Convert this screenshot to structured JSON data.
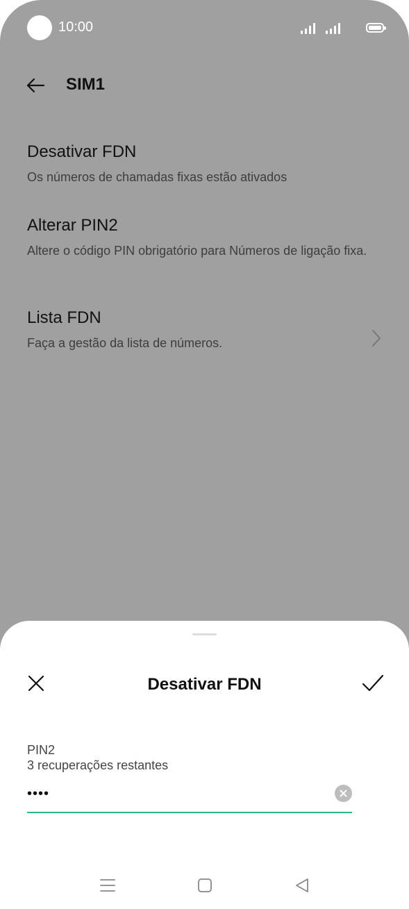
{
  "status_bar": {
    "time": "10:00"
  },
  "header": {
    "title": "SIM1"
  },
  "settings": [
    {
      "title": "Desativar FDN",
      "summary": "Os números de chamadas fixas estão ativados"
    },
    {
      "title": "Alterar PIN2",
      "summary": "Altere o código PIN obrigatório para Números de ligação fixa."
    },
    {
      "title": "Lista FDN",
      "summary": "Faça a gestão da lista de números."
    }
  ],
  "dialog": {
    "title": "Desativar FDN",
    "field_label": "PIN2",
    "field_hint": "3 recuperações restantes",
    "pin_value": "••••"
  },
  "colors": {
    "accent": "#2fb38d",
    "scrim": "#a0a0a0"
  },
  "icons": {
    "back": "arrow-left",
    "chevron": "chevron-right",
    "close": "close-x",
    "confirm": "checkmark",
    "clear": "clear-circle",
    "nav": [
      "menu",
      "home",
      "back-triangle"
    ]
  }
}
